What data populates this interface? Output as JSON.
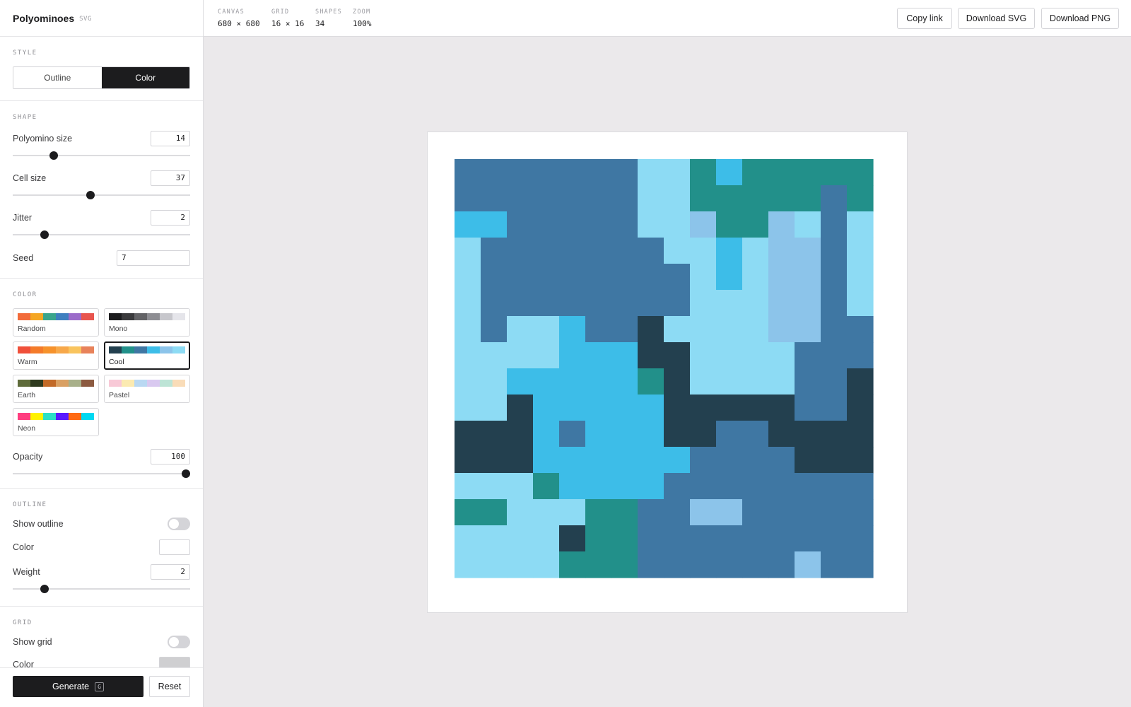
{
  "app": {
    "title": "Polyominoes",
    "format_badge": "SVG"
  },
  "style": {
    "section_title": "STYLE",
    "options": [
      "Outline",
      "Color"
    ],
    "selected": "Color"
  },
  "shape": {
    "section_title": "SHAPE",
    "polyomino_size": {
      "label": "Polyomino size",
      "value": "14",
      "slider_fraction": 0.23
    },
    "cell_size": {
      "label": "Cell size",
      "value": "37",
      "slider_fraction": 0.44
    },
    "jitter": {
      "label": "Jitter",
      "value": "2",
      "slider_fraction": 0.18
    },
    "seed": {
      "label": "Seed",
      "value": "7"
    }
  },
  "color": {
    "section_title": "COLOR",
    "palettes": [
      {
        "name": "Random",
        "colors": [
          "#f26b3a",
          "#f5a623",
          "#3aa58c",
          "#3f7fbf",
          "#9b6bc9",
          "#e8554e"
        ]
      },
      {
        "name": "Mono",
        "colors": [
          "#1c1c1e",
          "#3a3a3c",
          "#636366",
          "#8e8e93",
          "#c7c7cc",
          "#e5e5ea"
        ]
      },
      {
        "name": "Warm",
        "colors": [
          "#f0503a",
          "#f47b2a",
          "#f6922c",
          "#f7a84a",
          "#f9c45e",
          "#e8825a"
        ]
      },
      {
        "name": "Cool",
        "colors": [
          "#23404f",
          "#22908a",
          "#3f77a3",
          "#3dbde8",
          "#8cc4ea",
          "#8ddbf4"
        ]
      },
      {
        "name": "Earth",
        "colors": [
          "#5e6b3a",
          "#2e3a1e",
          "#c26a28",
          "#d9a063",
          "#a8b08a",
          "#8c5a40"
        ]
      },
      {
        "name": "Pastel",
        "colors": [
          "#f8c9d7",
          "#fbeab1",
          "#b9d8f2",
          "#d9c9f0",
          "#bde4d6",
          "#f9dcb8"
        ]
      },
      {
        "name": "Neon",
        "colors": [
          "#ff3d7f",
          "#fff200",
          "#2de0c6",
          "#5a1aff",
          "#ff6a13",
          "#00d9f2"
        ]
      }
    ],
    "selected": "Cool",
    "opacity": {
      "label": "Opacity",
      "value": "100",
      "slider_fraction": 1.0
    }
  },
  "outline": {
    "section_title": "OUTLINE",
    "show_outline": {
      "label": "Show outline",
      "on": false
    },
    "color": {
      "label": "Color",
      "value": "#ffffff"
    },
    "weight": {
      "label": "Weight",
      "value": "2",
      "slider_fraction": 0.18
    }
  },
  "grid": {
    "section_title": "GRID",
    "show_grid": {
      "label": "Show grid",
      "on": false
    },
    "color": {
      "label": "Color",
      "value": "#cfcfd1"
    }
  },
  "footer": {
    "generate_label": "Generate",
    "generate_shortcut": "G",
    "reset_label": "Reset"
  },
  "stats": [
    {
      "key": "CANVAS",
      "value": "680 × 680"
    },
    {
      "key": "GRID",
      "value": "16 × 16"
    },
    {
      "key": "SHAPES",
      "value": "34"
    },
    {
      "key": "ZOOM",
      "value": "100%"
    }
  ],
  "actions": {
    "copy_link": "Copy link",
    "download_svg": "Download SVG",
    "download_png": "Download PNG"
  },
  "artwork": {
    "colors": {
      "D": "#23404f",
      "T": "#22908a",
      "B": "#3f77a3",
      "S": "#3dbde8",
      "P": "#8cc4ea",
      "L": "#8ddbf4"
    },
    "rows": [
      "BBBBBBBLLTSTTTTT",
      "BBBBBBBLLTTTTTBT",
      "SSBBBBBLLPTTPLBL",
      "LBBBBBBBLLSLPPBL",
      "LBBBBBBBBLSLPPBL",
      "LBBBBBBBBLLLPPBL",
      "LBLLSBBDLLLLPPBB",
      "LLLLSSSDDLLLLBBB",
      "LLSSSSSTDLLLLBBD",
      "LLDSSSSSDDDDDBBD",
      "DDDSBSSSDDBBDDDD",
      "DDDSSSSSSBBBBDDD",
      "LLLTSSSSBBBBBBBB",
      "TTLLLTTBBPPBBBBB",
      "LLLLDTTBBBBBBBBB",
      "LLLLTTTBBBBBBPBB"
    ]
  }
}
